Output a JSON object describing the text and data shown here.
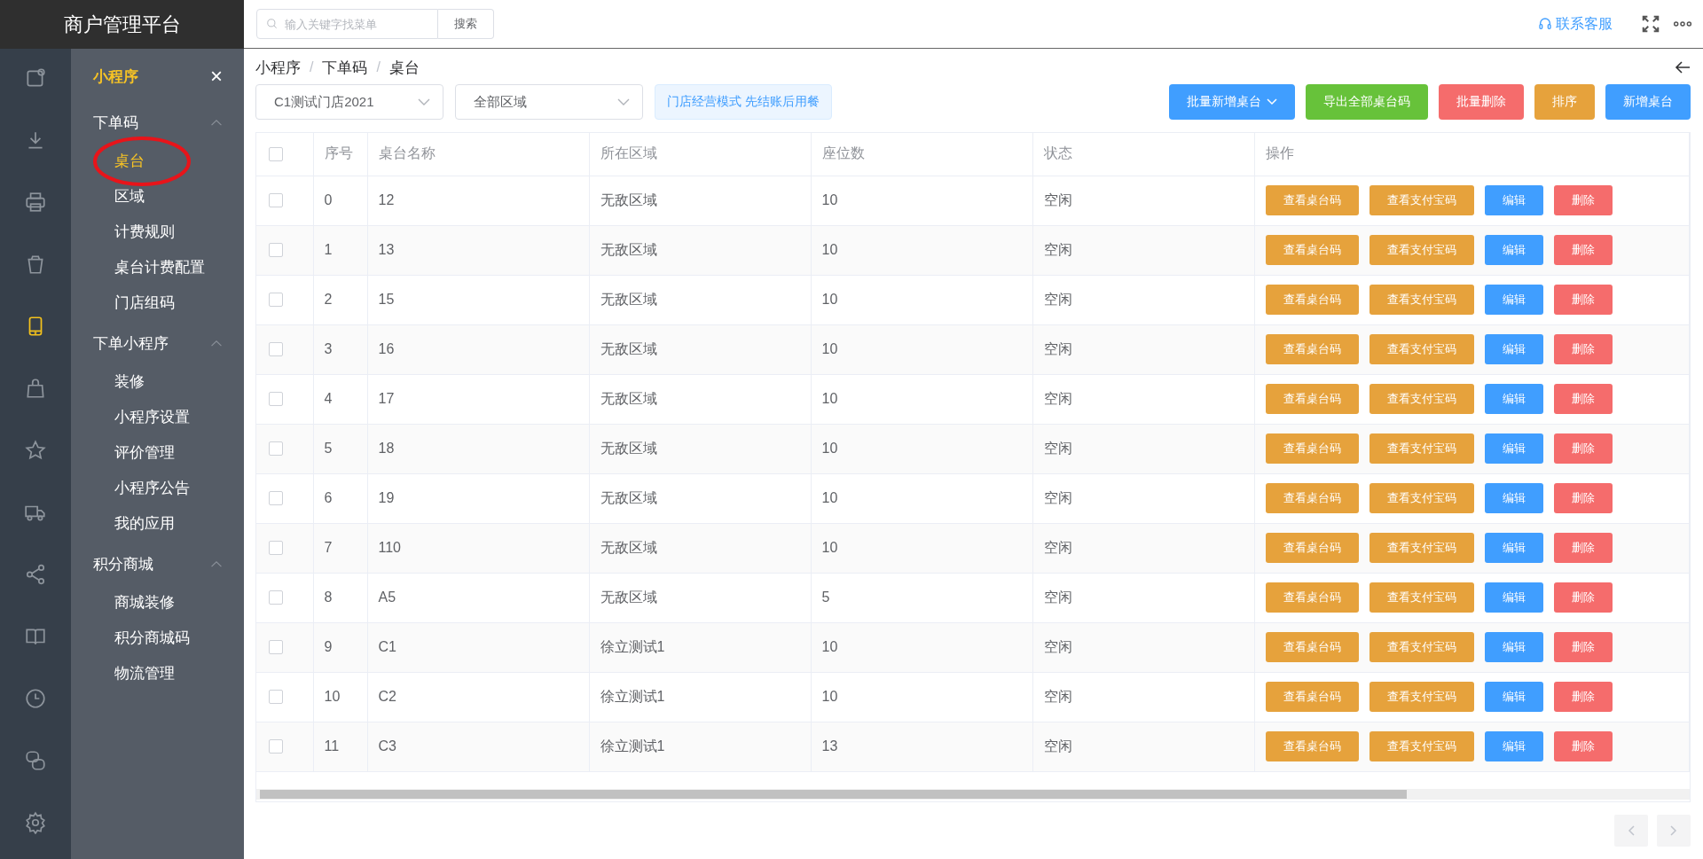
{
  "app_title": "商户管理平台",
  "search": {
    "placeholder": "输入关键字找菜单",
    "button": "搜索"
  },
  "header_links": [
    {
      "label": "联系客服"
    }
  ],
  "rail": [
    {
      "selected": false
    },
    {
      "selected": false
    },
    {
      "selected": false
    },
    {
      "selected": false
    },
    {
      "selected": true
    },
    {
      "selected": false
    },
    {
      "selected": false
    },
    {
      "selected": false
    },
    {
      "selected": false
    },
    {
      "selected": false
    },
    {
      "selected": false
    },
    {
      "selected": false
    },
    {
      "selected": false
    }
  ],
  "submenu": {
    "title": "小程序",
    "close": "×",
    "groups": [
      {
        "label": "下单码",
        "expanded": true,
        "items": [
          {
            "label": "桌台",
            "selected": true,
            "circled": true
          },
          {
            "label": "区域",
            "selected": false,
            "circled": false
          },
          {
            "label": "计费规则",
            "selected": false,
            "circled": false
          },
          {
            "label": "桌台计费配置",
            "selected": false,
            "circled": false
          },
          {
            "label": "门店组码",
            "selected": false,
            "circled": false
          }
        ]
      },
      {
        "label": "下单小程序",
        "expanded": true,
        "items": [
          {
            "label": "装修",
            "selected": false,
            "circled": false
          },
          {
            "label": "小程序设置",
            "selected": false,
            "circled": false
          },
          {
            "label": "评价管理",
            "selected": false,
            "circled": false
          },
          {
            "label": "小程序公告",
            "selected": false,
            "circled": false
          },
          {
            "label": "我的应用",
            "selected": false,
            "circled": false
          }
        ]
      },
      {
        "label": "积分商城",
        "expanded": true,
        "items": [
          {
            "label": "商城装修",
            "selected": false,
            "circled": false
          },
          {
            "label": "积分商城码",
            "selected": false,
            "circled": false
          },
          {
            "label": "物流管理",
            "selected": false,
            "circled": false
          }
        ]
      }
    ]
  },
  "breadcrumb": {
    "separator": "/",
    "items": [
      "小程序",
      "下单码",
      "桌台"
    ]
  },
  "filters": [
    {
      "value": "C1测试门店2021"
    },
    {
      "value": "全部区域"
    }
  ],
  "mode_tag": "门店经营模式 先结账后用餐",
  "toolbar_buttons": [
    {
      "label": "批量新增桌台",
      "kind": "primary",
      "dropdown": true
    },
    {
      "label": "导出全部桌台码",
      "kind": "success",
      "dropdown": false
    },
    {
      "label": "批量删除",
      "kind": "danger",
      "dropdown": false
    },
    {
      "label": "排序",
      "kind": "warning",
      "dropdown": false
    },
    {
      "label": "新增桌台",
      "kind": "primary",
      "dropdown": false
    }
  ],
  "table": {
    "select_all": {
      "checked": false
    },
    "columns": [
      "序号",
      "桌台名称",
      "所在区域",
      "座位数",
      "状态",
      "操作"
    ],
    "rows": [
      {
        "checked": false,
        "cells": [
          "0",
          "12",
          "无敌区域",
          "10",
          "空闲"
        ],
        "actions": [
          {
            "label": "查看桌台码",
            "kind": "warning"
          },
          {
            "label": "查看支付宝码",
            "kind": "warning"
          },
          {
            "label": "编辑",
            "kind": "primary"
          },
          {
            "label": "删除",
            "kind": "danger"
          }
        ]
      },
      {
        "checked": false,
        "cells": [
          "1",
          "13",
          "无敌区域",
          "10",
          "空闲"
        ],
        "actions": [
          {
            "label": "查看桌台码",
            "kind": "warning"
          },
          {
            "label": "查看支付宝码",
            "kind": "warning"
          },
          {
            "label": "编辑",
            "kind": "primary"
          },
          {
            "label": "删除",
            "kind": "danger"
          }
        ]
      },
      {
        "checked": false,
        "cells": [
          "2",
          "15",
          "无敌区域",
          "10",
          "空闲"
        ],
        "actions": [
          {
            "label": "查看桌台码",
            "kind": "warning"
          },
          {
            "label": "查看支付宝码",
            "kind": "warning"
          },
          {
            "label": "编辑",
            "kind": "primary"
          },
          {
            "label": "删除",
            "kind": "danger"
          }
        ]
      },
      {
        "checked": false,
        "cells": [
          "3",
          "16",
          "无敌区域",
          "10",
          "空闲"
        ],
        "actions": [
          {
            "label": "查看桌台码",
            "kind": "warning"
          },
          {
            "label": "查看支付宝码",
            "kind": "warning"
          },
          {
            "label": "编辑",
            "kind": "primary"
          },
          {
            "label": "删除",
            "kind": "danger"
          }
        ]
      },
      {
        "checked": false,
        "cells": [
          "4",
          "17",
          "无敌区域",
          "10",
          "空闲"
        ],
        "actions": [
          {
            "label": "查看桌台码",
            "kind": "warning"
          },
          {
            "label": "查看支付宝码",
            "kind": "warning"
          },
          {
            "label": "编辑",
            "kind": "primary"
          },
          {
            "label": "删除",
            "kind": "danger"
          }
        ]
      },
      {
        "checked": false,
        "cells": [
          "5",
          "18",
          "无敌区域",
          "10",
          "空闲"
        ],
        "actions": [
          {
            "label": "查看桌台码",
            "kind": "warning"
          },
          {
            "label": "查看支付宝码",
            "kind": "warning"
          },
          {
            "label": "编辑",
            "kind": "primary"
          },
          {
            "label": "删除",
            "kind": "danger"
          }
        ]
      },
      {
        "checked": false,
        "cells": [
          "6",
          "19",
          "无敌区域",
          "10",
          "空闲"
        ],
        "actions": [
          {
            "label": "查看桌台码",
            "kind": "warning"
          },
          {
            "label": "查看支付宝码",
            "kind": "warning"
          },
          {
            "label": "编辑",
            "kind": "primary"
          },
          {
            "label": "删除",
            "kind": "danger"
          }
        ]
      },
      {
        "checked": false,
        "cells": [
          "7",
          "110",
          "无敌区域",
          "10",
          "空闲"
        ],
        "actions": [
          {
            "label": "查看桌台码",
            "kind": "warning"
          },
          {
            "label": "查看支付宝码",
            "kind": "warning"
          },
          {
            "label": "编辑",
            "kind": "primary"
          },
          {
            "label": "删除",
            "kind": "danger"
          }
        ]
      },
      {
        "checked": false,
        "cells": [
          "8",
          "A5",
          "无敌区域",
          "5",
          "空闲"
        ],
        "actions": [
          {
            "label": "查看桌台码",
            "kind": "warning"
          },
          {
            "label": "查看支付宝码",
            "kind": "warning"
          },
          {
            "label": "编辑",
            "kind": "primary"
          },
          {
            "label": "删除",
            "kind": "danger"
          }
        ]
      },
      {
        "checked": false,
        "cells": [
          "9",
          "C1",
          "徐立测试1",
          "10",
          "空闲"
        ],
        "actions": [
          {
            "label": "查看桌台码",
            "kind": "warning"
          },
          {
            "label": "查看支付宝码",
            "kind": "warning"
          },
          {
            "label": "编辑",
            "kind": "primary"
          },
          {
            "label": "删除",
            "kind": "danger"
          }
        ]
      },
      {
        "checked": false,
        "cells": [
          "10",
          "C2",
          "徐立测试1",
          "10",
          "空闲"
        ],
        "actions": [
          {
            "label": "查看桌台码",
            "kind": "warning"
          },
          {
            "label": "查看支付宝码",
            "kind": "warning"
          },
          {
            "label": "编辑",
            "kind": "primary"
          },
          {
            "label": "删除",
            "kind": "danger"
          }
        ]
      },
      {
        "checked": false,
        "cells": [
          "11",
          "C3",
          "徐立测试1",
          "13",
          "空闲"
        ],
        "actions": [
          {
            "label": "查看桌台码",
            "kind": "warning"
          },
          {
            "label": "查看支付宝码",
            "kind": "warning"
          },
          {
            "label": "编辑",
            "kind": "primary"
          },
          {
            "label": "删除",
            "kind": "danger"
          }
        ]
      }
    ]
  },
  "pager": {
    "prev_disabled": true,
    "next_disabled": true
  }
}
